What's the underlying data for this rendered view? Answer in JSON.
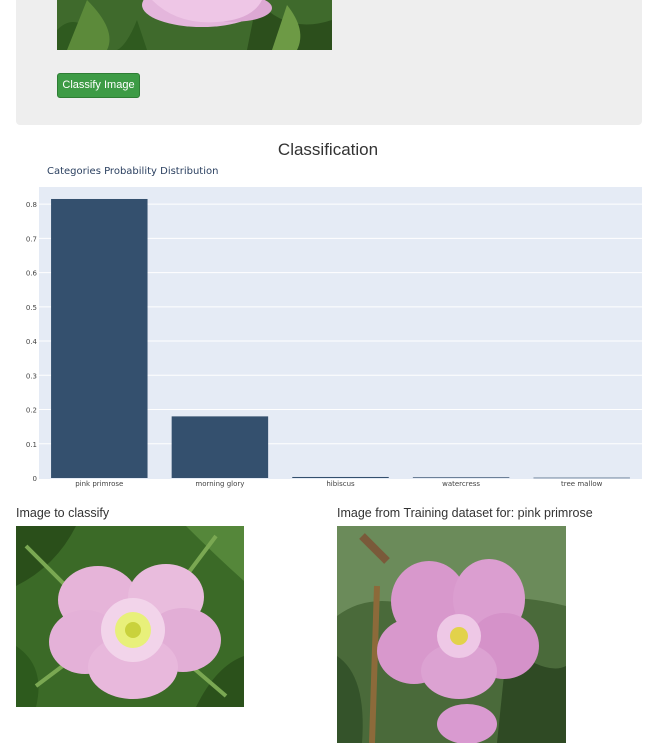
{
  "upload": {
    "button_label": "Classify Image"
  },
  "section_title": "Classification",
  "chart_data": {
    "type": "bar",
    "title": "Categories Probability Distribution",
    "categories": [
      "pink primrose",
      "morning glory",
      "hibiscus",
      "watercress",
      "tree mallow"
    ],
    "values": [
      0.815,
      0.18,
      0.003,
      0.002,
      0.001
    ],
    "ylim": [
      0,
      0.85
    ],
    "yticks": [
      0,
      0.1,
      0.2,
      0.3,
      0.4,
      0.5,
      0.6,
      0.7,
      0.8
    ],
    "xlabel": "",
    "ylabel": "",
    "grid": true,
    "colors": {
      "bar": "#34506e",
      "plot_bg": "#e5ebf5",
      "grid": "#ffffff",
      "tick_text": "#444444"
    }
  },
  "left_image": {
    "label": "Image to classify"
  },
  "right_image": {
    "label": "Image from Training dataset for: pink primrose"
  }
}
